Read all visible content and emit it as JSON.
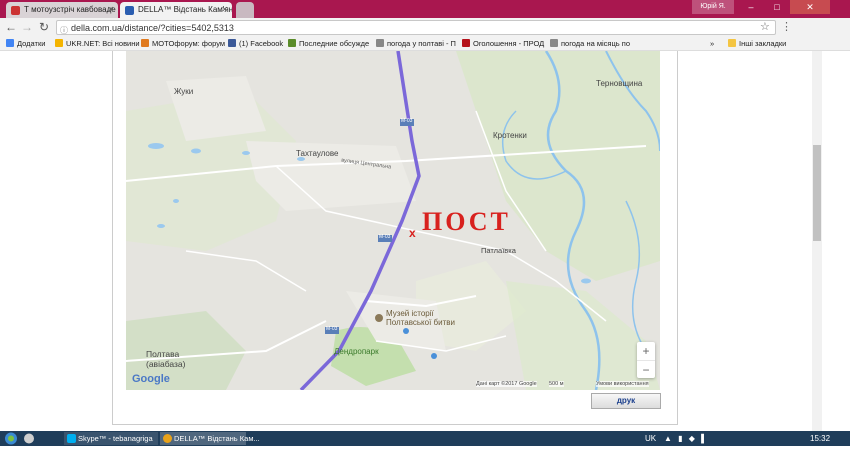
{
  "browser": {
    "tabs": [
      {
        "label": "Т мотоузстріч кавбоваде",
        "active": false
      },
      {
        "label": "DELLA™ Відстань Кам'ян",
        "active": true
      }
    ],
    "window_controls": {
      "user": "Юрій Я.",
      "minimize": "–",
      "maximize": "□",
      "close": "✕"
    },
    "url": "della.com.ua/distance/?cities=5402,5313",
    "bookmarks": [
      {
        "label": "Додатки",
        "color": "#4285f4"
      },
      {
        "label": "UKR.NET: Всі новини",
        "color": "#f4b400"
      },
      {
        "label": "MOTOфорум: форум",
        "color": "#e07a1f"
      },
      {
        "label": "(1) Facebook",
        "color": "#3b5998"
      },
      {
        "label": "Последние обсужде",
        "color": "#5b8c2a"
      },
      {
        "label": "погода у полтаві - П",
        "color": "#888888"
      },
      {
        "label": "Оголошення - ПРОД",
        "color": "#b5121b"
      },
      {
        "label": "погода на місяць по",
        "color": "#888888"
      },
      {
        "label": "Інші закладки",
        "color": "#f4c542"
      }
    ]
  },
  "map": {
    "labels": {
      "zhuky": "Жуки",
      "ternivshchyna": "Терновщина",
      "krotenky": "Кротенки",
      "takhtaulove": "Тахтаулове",
      "tsentralna": "вулиця Центральна",
      "patlaivka": "Патлаївка",
      "museum_1": "Музей історії",
      "museum_2": "Полтавської битви",
      "dendropark": "Дендропарк",
      "poltava_1": "Полтава",
      "poltava_2": "(авіабаза)",
      "road_m03": "М-03",
      "handwritten": "ПОСТ",
      "google": "Google",
      "attribution": "Дані карт ©2017 Google",
      "scale": "500 м",
      "terms": "Умови використання"
    },
    "zoom_in": "+",
    "zoom_out": "−",
    "route_color": "#7b68d9",
    "handwriting_color": "#d8211e"
  },
  "page": {
    "print_button": "друк"
  },
  "taskbar": {
    "items": [
      {
        "label": "Skype™ - tebanagriga",
        "color": "#00aff0"
      },
      {
        "label": "DELLA™ Відстань Кам...",
        "color": "#e8a21a"
      }
    ],
    "lang": "UK",
    "time": "15:32"
  }
}
